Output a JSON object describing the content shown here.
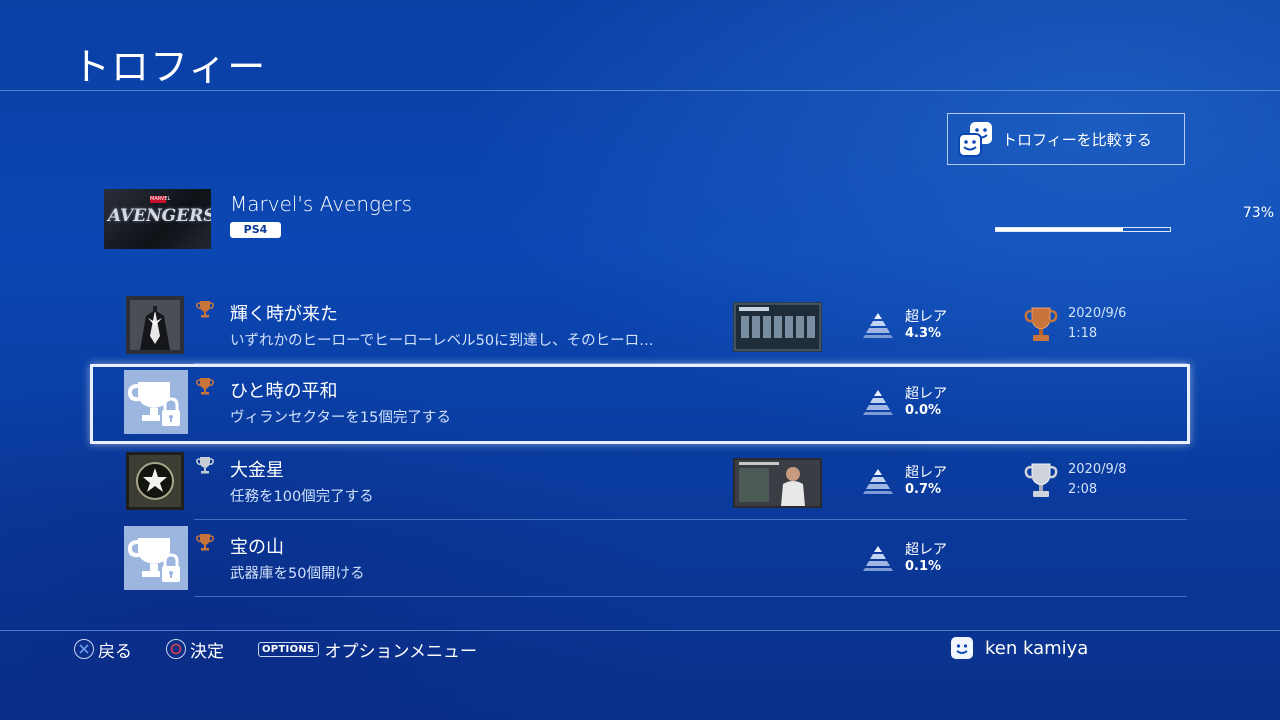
{
  "page": {
    "title": "トロフィー"
  },
  "compare": {
    "label": "トロフィーを比較する"
  },
  "game": {
    "name": "Marvel's Avengers",
    "platform": "PS4",
    "progress_text": "73%",
    "progress": 0.73,
    "cover_word": "AVENGERS",
    "cover_brand": "MARVEL"
  },
  "trophies": [
    {
      "name": "輝く時が来た",
      "description": "いずれかのヒーローでヒーローレベル50に到達し、そのヒーロ…",
      "grade": "bronze",
      "rarity_label": "超レア",
      "rarity_pct": "4.3%",
      "date": "2020/9/6",
      "time": "1:18",
      "locked": false
    },
    {
      "name": "ひと時の平和",
      "description": "ヴィランセクターを15個完了する",
      "grade": "bronze",
      "rarity_label": "超レア",
      "rarity_pct": "0.0%",
      "locked": true
    },
    {
      "name": "大金星",
      "description": "任務を100個完了する",
      "grade": "silver",
      "rarity_label": "超レア",
      "rarity_pct": "0.7%",
      "date": "2020/9/8",
      "time": "2:08",
      "locked": false
    },
    {
      "name": "宝の山",
      "description": "武器庫を50個開ける",
      "grade": "bronze",
      "rarity_label": "超レア",
      "rarity_pct": "0.1%",
      "locked": true
    }
  ],
  "footer": {
    "back_label": "戻る",
    "confirm_label": "決定",
    "options_glyph": "OPTIONS",
    "options_label": "オプションメニュー"
  },
  "user": {
    "name": "ken kamiya"
  },
  "colors": {
    "background": "#0b47b3",
    "bronze": "#c8743a",
    "silver": "#c9ced6",
    "cross": "#6f9be8",
    "circle": "#e0414f"
  }
}
